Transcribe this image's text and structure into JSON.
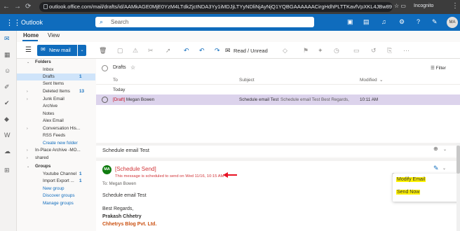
{
  "browser": {
    "url": "outlook.office.com/mail/drafts/id/AAMkAGE0MjE0YzM4LTdkZjctNDA3Yy1iMDJjLTYyNDliNjAyNjQ1YQBGAAAAAACirgHdhPLTTKavfVpXKL4JBw89",
    "incognito_label": "Incognito"
  },
  "header": {
    "brand": "Outlook",
    "search_placeholder": "Search",
    "avatar_initials": "MA"
  },
  "ribbon": {
    "tabs": [
      "Home",
      "View"
    ],
    "new_mail_label": "New mail",
    "read_unread_label": "Read / Unread"
  },
  "folders": {
    "items": [
      {
        "label": "Folders",
        "type": "group"
      },
      {
        "label": "Inbox",
        "type": "folder"
      },
      {
        "label": "Drafts",
        "type": "folder",
        "count": "1",
        "selected": true
      },
      {
        "label": "Sent Items",
        "type": "folder"
      },
      {
        "label": "Deleted Items",
        "type": "folder",
        "count": "13",
        "expandable": true
      },
      {
        "label": "Junk Email",
        "type": "folder",
        "expandable": true
      },
      {
        "label": "Archive",
        "type": "folder"
      },
      {
        "label": "Notes",
        "type": "folder"
      },
      {
        "label": "Alex Email",
        "type": "folder"
      },
      {
        "label": "Conversation His...",
        "type": "folder",
        "expandable": true
      },
      {
        "label": "RSS Feeds",
        "type": "folder"
      },
      {
        "label": "Create new folder",
        "type": "link"
      },
      {
        "label": "In-Place Archive -MO...",
        "type": "sub"
      },
      {
        "label": "shared",
        "type": "sub"
      },
      {
        "label": "Groups",
        "type": "group"
      },
      {
        "label": "Youtube Channel",
        "type": "folder",
        "count": "1"
      },
      {
        "label": "Import Export ...",
        "type": "folder",
        "count": "1"
      },
      {
        "label": "New group",
        "type": "link"
      },
      {
        "label": "Discover groups",
        "type": "link"
      },
      {
        "label": "Manage groups",
        "type": "link"
      }
    ]
  },
  "list": {
    "folder_title": "Drafts",
    "filter_label": "Filter",
    "columns": {
      "to": "To",
      "subject": "Subject",
      "modified": "Modified"
    },
    "group_label": "Today",
    "rows": [
      {
        "draft_tag": "[Draft]",
        "to": "Megan Bowen",
        "subject": "Schedule email Test",
        "preview": "Schedule email Test Best Regards,",
        "modified": "10:11 AM"
      }
    ]
  },
  "reading": {
    "subject": "Schedule email Test",
    "sender_initials": "MA",
    "schedule_title": "[Schedule Send]",
    "schedule_message": "This message is scheduled to send on Wed 11/16, 10:15 AM",
    "to_line": "To: Megan Bowen",
    "body_line1": "Schedule email Test",
    "body_line2": "Best Regards,",
    "body_name": "Prakash Chhetry",
    "body_company": "Chhetrys Blog Pvt. Ltd."
  },
  "popup": {
    "modify_label": "Modify Email",
    "send_label": "Send Now"
  },
  "colors": {
    "brand": "#0f6cbd",
    "selected_row": "#dcd3ec",
    "schedule_red": "#d13438",
    "highlight": "#fff200"
  }
}
